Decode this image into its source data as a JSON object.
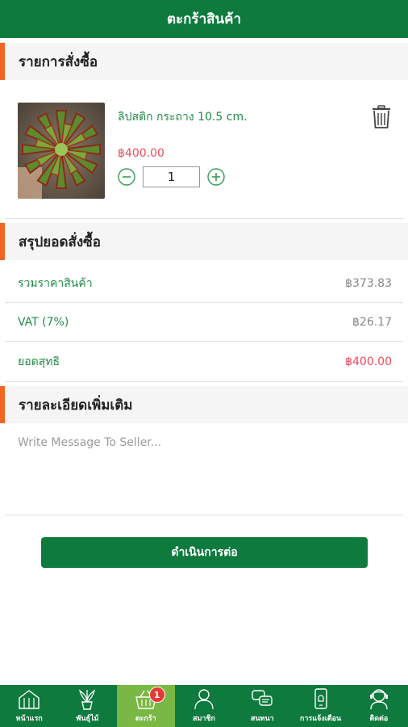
{
  "header": {
    "title": "ตะกร้าสินค้า"
  },
  "order_section": {
    "title": "รายการสั่งซื้อ"
  },
  "item": {
    "name": "ลิปสติก กระถาง 10.5 cm.",
    "price": "฿400.00",
    "quantity": "1"
  },
  "summary_section": {
    "title": "สรุปยอดสั่งซื้อ",
    "rows": [
      {
        "label": "รวมราคาสินค้า",
        "value": "฿373.83"
      },
      {
        "label": "VAT (7%)",
        "value": "฿26.17"
      },
      {
        "label": "ยอดสุทธิ",
        "value": "฿400.00"
      }
    ]
  },
  "details_section": {
    "title": "รายละเอียดเพิ่มเติม",
    "message_placeholder": "Write Message To Seller..."
  },
  "proceed_label": "ดำเนินการต่อ",
  "colors": {
    "primary": "#0e7a3e",
    "accent": "#f26522",
    "price": "#f04a5a",
    "active_tab": "#79b845"
  },
  "bottom_nav": {
    "items": [
      {
        "label": "หน้าแรก",
        "icon": "home-icon"
      },
      {
        "label": "พันธุ์ไม้",
        "icon": "plant-icon"
      },
      {
        "label": "ตะกร้า",
        "icon": "basket-icon",
        "badge": "1",
        "active": true
      },
      {
        "label": "สมาชิก",
        "icon": "member-icon"
      },
      {
        "label": "สนทนา",
        "icon": "chat-icon"
      },
      {
        "label": "การแจ้งเตือน",
        "icon": "notification-icon"
      },
      {
        "label": "ติดต่อ",
        "icon": "contact-icon"
      }
    ]
  }
}
